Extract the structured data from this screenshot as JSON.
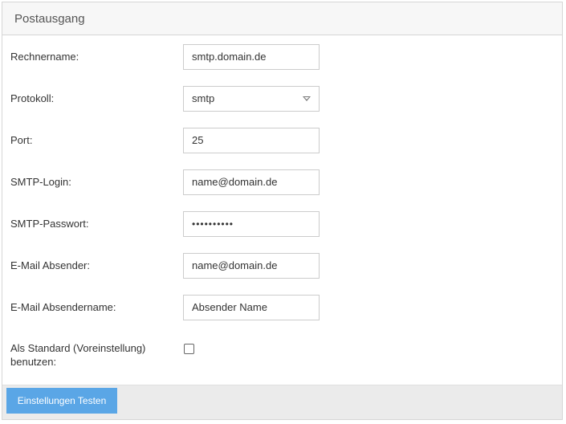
{
  "panel": {
    "title": "Postausgang"
  },
  "form": {
    "hostname": {
      "label": "Rechnername:",
      "value": "smtp.domain.de"
    },
    "protocol": {
      "label": "Protokoll:",
      "value": "smtp"
    },
    "port": {
      "label": "Port:",
      "value": "25"
    },
    "smtp_login": {
      "label": "SMTP-Login:",
      "value": "name@domain.de"
    },
    "smtp_password": {
      "label": "SMTP-Passwort:",
      "value": "••••••••••"
    },
    "sender_email": {
      "label": "E-Mail Absender:",
      "value": "name@domain.de"
    },
    "sender_name": {
      "label": "E-Mail Absendername:",
      "value": "Absender Name"
    },
    "use_default": {
      "label": "Als Standard (Voreinstellung) benutzen:",
      "checked": false
    }
  },
  "footer": {
    "test_button_label": "Einstellungen Testen"
  },
  "colors": {
    "button": "#5aa6e6",
    "footer": "#ebebeb",
    "border": "#d6d6d6"
  }
}
